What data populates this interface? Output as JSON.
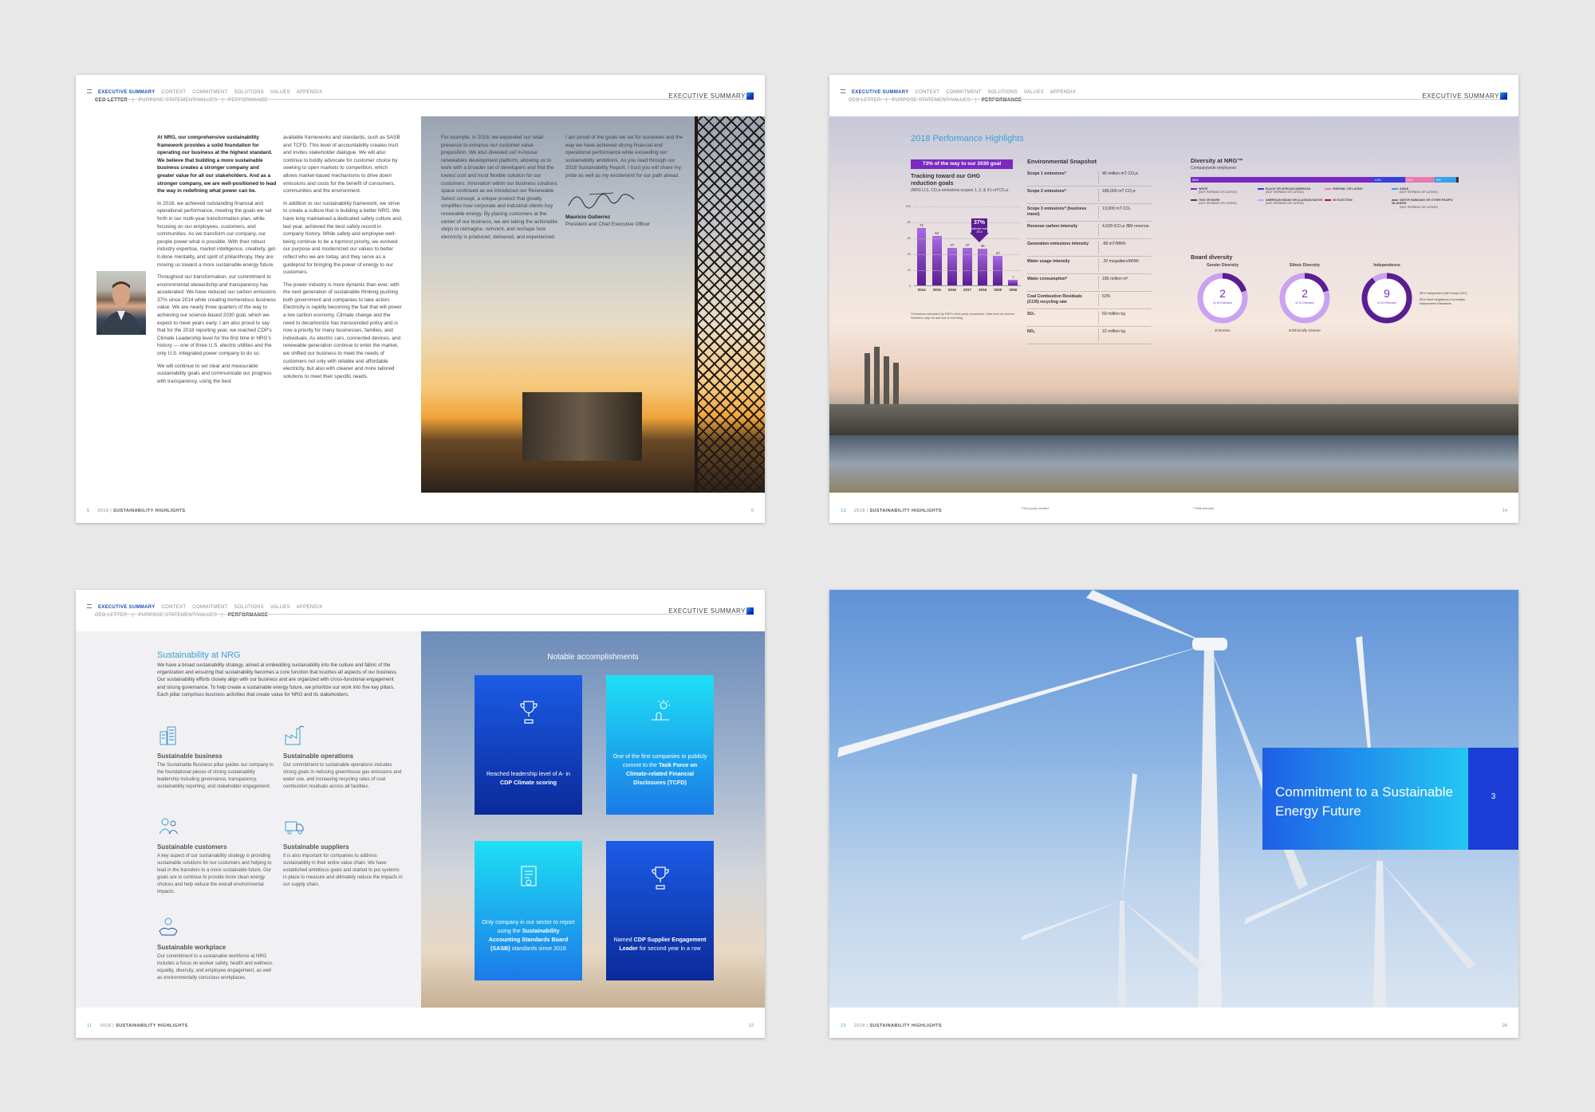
{
  "nav": {
    "tabs": [
      "EXECUTIVE SUMMARY",
      "CONTEXT",
      "COMMITMENT",
      "SOLUTIONS",
      "VALUES",
      "APPENDIX"
    ],
    "subs": [
      "CEO LETTER",
      "|",
      "PURPOSE STATEMENT/VALUES",
      "|",
      "PERFORMANCE"
    ],
    "section": "EXECUTIVE SUMMARY"
  },
  "footer": {
    "year": "2018",
    "sep": "|",
    "label": "SUSTAINABILITY HIGHLIGHTS"
  },
  "spread1": {
    "page_left": "5",
    "page_right": "6",
    "col1": [
      "At NRG, our comprehensive sustainability framework provides a solid foundation for operating our business at the highest standard. We believe that building a more sustainable business creates a stronger company and greater value for all our stakeholders. And as a stronger company, we are well-positioned to lead the way in redefining what power can be.",
      "In 2018, we achieved outstanding financial and operational performance, meeting the goals we set forth in our multi-year transformation plan, while focusing on our employees, customers, and communities. As we transform our company, our people power what is possible. With their robust industry expertise, market intelligence, creativity, get-it-done mentality, and spirit of philanthropy, they are moving us toward a more sustainable energy future.",
      "Throughout our transformation, our commitment to environmental stewardship and transparency has accelerated. We have reduced our carbon emissions 37% since 2014 while creating tremendous business value. We are nearly three quarters of the way to achieving our science-based 2030 goal, which we expect to meet years early. I am also proud to say that for the 2018 reporting year, we reached CDP's Climate Leadership level for the first time in NRG's history — one of three U.S. electric utilities and the only U.S. integrated power company to do so.",
      "We will continue to set clear and measurable sustainability goals and communicate our progress with transparency, using the best"
    ],
    "col2": [
      "available frameworks and standards, such as SASB and TCFD. This level of accountability creates trust and invites stakeholder dialogue. We will also continue to boldly advocate for customer choice by seeking to open markets to competition, which allows market-based mechanisms to drive down emissions and costs for the benefit of consumers, communities and the environment.",
      "In addition to our sustainability framework, we strive to create a culture that is building a better NRG. We have long maintained a dedicated safety culture and, last year, achieved the best safety record in company history. While safety and employee well-being continue to be a topmost priority, we evolved our purpose and modernized our values to better reflect who we are today, and they serve as a guidepost for bringing the power of energy to our customers.",
      "The power industry is more dynamic than ever, with the next generation of sustainable thinking pushing both government and companies to take action. Electricity is rapidly becoming the fuel that will power a low carbon economy. Climate change and the need to decarbonize has transcended policy and is now a priority for many businesses, families, and individuals. As electric cars, connected devices, and renewable generation continue to enter the market, we shifted our business to meet the needs of customers not only with reliable and affordable electricity, but also with cleaner and more tailored solutions to meet their specific needs."
    ],
    "col3": "For example, in 2018, we expanded our retail presence to enhance our customer value proposition. We also divested our in-house renewables development platform, allowing us to work with a broader set of developers and find the lowest cost and most flexible solution for our customers. Innovation within our business solutions space continued as we introduced our Renewable Select concept, a unique product that greatly simplifies how corporate and industrial clients buy renewable energy. By placing customers at the center of our business, we are taking the actionable steps to reimagine, reinvent, and reshape how electricity is produced, delivered, and experienced.",
    "col4": "I am proud of the goals we set for ourselves and the way we have achieved strong financial and operational performance while exceeding our sustainability ambitions. As you read through our 2018 Sustainability Report, I trust you will share my pride as well as my excitement for our path ahead.",
    "signer_name": "Mauricio Gutierrez",
    "signer_title": "President and Chief Executive Officer"
  },
  "spread2": {
    "page_left": "13",
    "page_right": "14",
    "title": "2018 Performance Highlights",
    "ghg": {
      "badge": "73% of the way to our 2030 goal",
      "heading": "Tracking toward our GHG reduction goals",
      "subheading": "(NRG U.S. CO₂e emissions scopes 1, 2, & 3¹) mTCO₂e",
      "callout_value": "37%",
      "callout_text": "reduction from 2014",
      "note": "¹Emissions calculated by NRG's third-party consultants. Data from all sources. Numbers may not add due to rounding."
    },
    "env": {
      "title": "Environmental Snapshot",
      "rows": [
        {
          "label": "Scope 1 emissions*",
          "value": "46 million mT CO₂e"
        },
        {
          "label": "Scope 2 emissions*",
          "value": "185,000 mT CO₂e"
        },
        {
          "label": "Scope 3 emissions* (business travel)",
          "value": "13,000 mT CO₂"
        },
        {
          "label": "Revenue carbon intensity",
          "value": "4,628 tCO₂e /$M revenue"
        },
        {
          "label": "Generation emissions intensity",
          "value": ".68 mT/MWh"
        },
        {
          "label": "Water usage intensity",
          "value": ".20 megaliters/MWh"
        },
        {
          "label": "Water consumption*",
          "value": "185 million m³"
        },
        {
          "label": "Coal Combustion Residuals (CCR) recycling rate",
          "value": "63%"
        },
        {
          "label": "SO₂",
          "value": "60 million kg"
        },
        {
          "label": "NOₓ",
          "value": "22 million kg"
        }
      ],
      "foot1": "*Third-party verified",
      "foot2": "**Self-selected"
    },
    "diversity": {
      "title": "Diversity at NRG™",
      "subtitle": "Companywide employees",
      "segments": [
        {
          "label": "68%",
          "value": 68,
          "color": "#7a2ac0"
        },
        {
          "label": "12%",
          "value": 12,
          "color": "#3b3fd8"
        },
        {
          "label": "11%",
          "value": 11,
          "color": "#e87ab0"
        },
        {
          "label": "8%",
          "value": 8,
          "color": "#3aa0e6"
        },
        {
          "label": "",
          "value": 1,
          "color": "#333"
        }
      ],
      "legend": [
        {
          "label": "WHITE",
          "sub": "(NOT HISPANIC OR LATINO)",
          "color": "#7a2ac0"
        },
        {
          "label": "BLACK OR AFRICAN AMERICAN",
          "sub": "(NOT HISPANIC OR LATINO)",
          "color": "#3b3fd8"
        },
        {
          "label": "HISPANIC OR LATINO",
          "sub": "",
          "color": "#e87ab0"
        },
        {
          "label": "ASIAN",
          "sub": "(NOT HISPANIC OR LATINO)",
          "color": "#3aa0e6"
        },
        {
          "label": "TWO OR MORE",
          "sub": "(NOT HISPANIC OR LATINO)",
          "color": "#444"
        },
        {
          "label": "AMERICAN INDIAN OR ALASKAN NATIVE",
          "sub": "(NOT HISPANIC OR LATINO)",
          "color": "#c9a2f0"
        },
        {
          "label": "NO ELECTION",
          "sub": "",
          "color": "#a01a3a"
        },
        {
          "label": "NATIVE HAWAIIAN OR OTHER PACIFIC ISLANDER",
          "sub": "(NOT HISPANIC OR LATINO)",
          "color": "#7b7b7b"
        }
      ]
    },
    "board": {
      "title": "Board diversity",
      "rings": [
        {
          "heading": "Gender Diversity",
          "number": "2",
          "of": "of 10 Directors",
          "caption_num": "2",
          "caption": "Women",
          "fraction": 0.2
        },
        {
          "heading": "Ethnic Diversity",
          "number": "2",
          "of": "of 10 Directors",
          "caption_num": "2",
          "caption": "Ethnically Diverse",
          "fraction": 0.2
        },
        {
          "heading": "Independence",
          "number": "9",
          "of": "of 10 Directors",
          "caption_num": "",
          "caption": "",
          "fraction": 0.9
        }
      ],
      "indep_note1": "90% Independent (All Except CEO)",
      "indep_note2": "90% Meet Heightened Committee Independent Standards"
    }
  },
  "chart_data": {
    "type": "bar",
    "title": "Tracking toward our GHG reduction goals",
    "categories": [
      "2014",
      "2015",
      "2016",
      "2017",
      "2018",
      "2030",
      "2050"
    ],
    "values": [
      72,
      62,
      47,
      47,
      46,
      37,
      7
    ],
    "ylim": [
      0,
      100
    ],
    "yticks": [
      "0",
      "20",
      "40",
      "60",
      "80",
      "100"
    ]
  },
  "spread3": {
    "page_left": "11",
    "page_right": "12",
    "title": "Sustainability at NRG",
    "intro": "We have a broad sustainability strategy, aimed at embedding sustainability into the culture and fabric of the organization and ensuring that sustainability becomes a core function that touches all aspects of our business. Our sustainability efforts closely align with our business and are organized with cross-functional engagement and strong governance. To help create a sustainable energy future, we prioritize our work into five key pillars. Each pillar comprises business activities that create value for NRG and its stakeholders.",
    "pillars": [
      {
        "title": "Sustainable business",
        "text": "The Sustainable Business pillar guides our company in the foundational pieces of strong sustainability leadership including governance, transparency, sustainability reporting, and stakeholder engagement."
      },
      {
        "title": "Sustainable operations",
        "text": "Our commitment to sustainable operations includes strong goals in reducing greenhouse gas emissions and water use, and increasing recycling rates of coal combustion residuals across all facilities."
      },
      {
        "title": "Sustainable customers",
        "text": "A key aspect of our sustainability strategy is providing sustainable solutions for our customers and helping to lead in the transition to a more sustainable future. Our goals are to continue to provide more clean energy choices and help reduce the overall environmental impacts."
      },
      {
        "title": "Sustainable suppliers",
        "text": "It is also important for companies to address sustainability in their entire value chain. We have established ambitious goals and started to put systems in place to measure and ultimately reduce the impacts in our supply chain."
      },
      {
        "title": "Sustainable workplace",
        "text": "Our commitment to a sustainable workforce at NRG includes a focus on worker safety, health and wellness, equality, diversity, and employee engagement, as well as environmentally conscious workplaces."
      }
    ],
    "accomplishments_title": "Notable accomplishments",
    "cards": [
      {
        "pre": "Reached leadership level of A- in",
        "bold": "CDP Climate scoring",
        "post": ""
      },
      {
        "pre": "One of the first companies to publicly commit to the",
        "bold": "Task Force on Climate-related Financial Disclosures (TCFD)",
        "post": ""
      },
      {
        "pre": "Only company in our sector to report using the",
        "bold": "Sustainability Accounting Standards Board (SASB)",
        "post": "standards since 2016"
      },
      {
        "pre": "Named",
        "bold": "CDP Supplier Engagement Leader",
        "post": "for second year in a row"
      }
    ]
  },
  "spread4": {
    "page_left": "23",
    "page_right": "24",
    "banner_title": "Commitment to a Sustainable Energy Future",
    "banner_number": "3"
  },
  "colors": {
    "accent": "#1a4fb0",
    "cyan": "#3aa0d6",
    "purple": "#7a2ac0"
  }
}
